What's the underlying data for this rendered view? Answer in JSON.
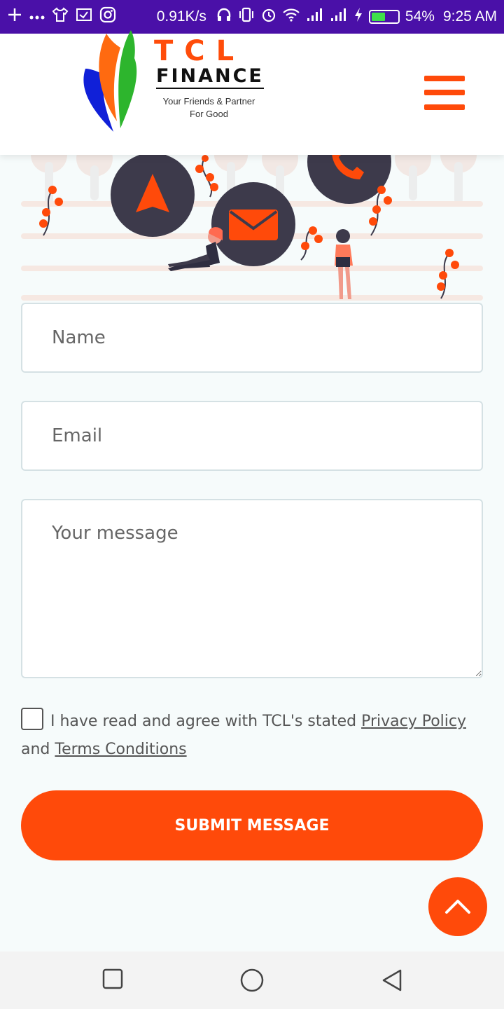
{
  "status_bar": {
    "net_speed": "0.91K/s",
    "battery": "54%",
    "battery_level": 0.54,
    "time": "9:25 AM"
  },
  "header": {
    "brand_name": "TCL",
    "brand_sub": "FINANCE",
    "tagline_line1": "Your Friends & Partner",
    "tagline_line2": "For Good",
    "menu_icon": "hamburger-icon"
  },
  "form": {
    "name_placeholder": "Name",
    "email_placeholder": "Email",
    "message_placeholder": "Your message",
    "agree_prefix": "I have read and agree with TCL's stated",
    "privacy_link": "Privacy Policy",
    "agree_and": "and",
    "terms_link": "Terms Conditions",
    "submit_label": "SUBMIT MESSAGE"
  },
  "colors": {
    "accent": "#ff4a0a",
    "status_bar": "#4a10a8",
    "dark_circle": "#3d3a4b"
  }
}
